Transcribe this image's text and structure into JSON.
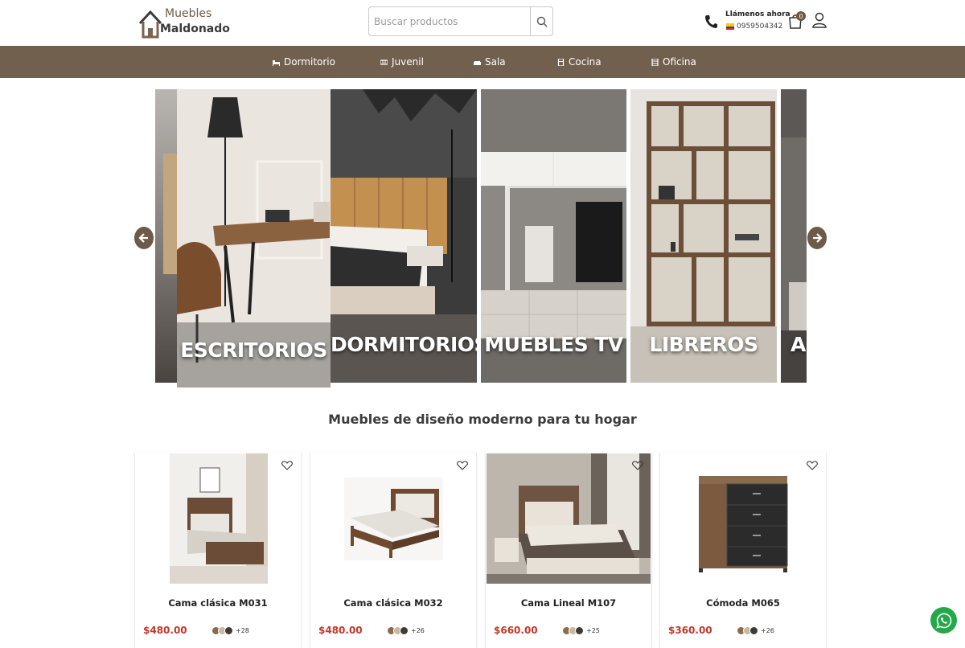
{
  "brand": {
    "line1": "Muebles",
    "line2": "Maldonado"
  },
  "search": {
    "placeholder": "Buscar productos"
  },
  "contact": {
    "label": "Llámenos ahora",
    "number": "0959504342"
  },
  "cart": {
    "count": "0"
  },
  "nav": {
    "items": [
      {
        "label": "Dormitorio"
      },
      {
        "label": "Juvenil"
      },
      {
        "label": "Sala"
      },
      {
        "label": "Cocina"
      },
      {
        "label": "Oficina"
      }
    ]
  },
  "carousel": {
    "slides": [
      {
        "label": "ESCRITORIOS"
      },
      {
        "label": "DORMITORIOS"
      },
      {
        "label": "MUEBLES TV"
      },
      {
        "label": "LIBREROS"
      },
      {
        "label": "A"
      }
    ]
  },
  "section": {
    "title": "Muebles de diseño moderno para tu hogar"
  },
  "products": [
    {
      "name": "Cama clásica M031",
      "price": "$480.00",
      "more": "+28"
    },
    {
      "name": "Cama clásica M032",
      "price": "$480.00",
      "more": "+26"
    },
    {
      "name": "Cama Lineal M107",
      "price": "$660.00",
      "more": "+25"
    },
    {
      "name": "Cómoda M065",
      "price": "$360.00",
      "more": "+26"
    }
  ],
  "colors": {
    "brand_brown": "#72604f",
    "price_red": "#c0392b",
    "whatsapp_green": "#25a84b"
  }
}
